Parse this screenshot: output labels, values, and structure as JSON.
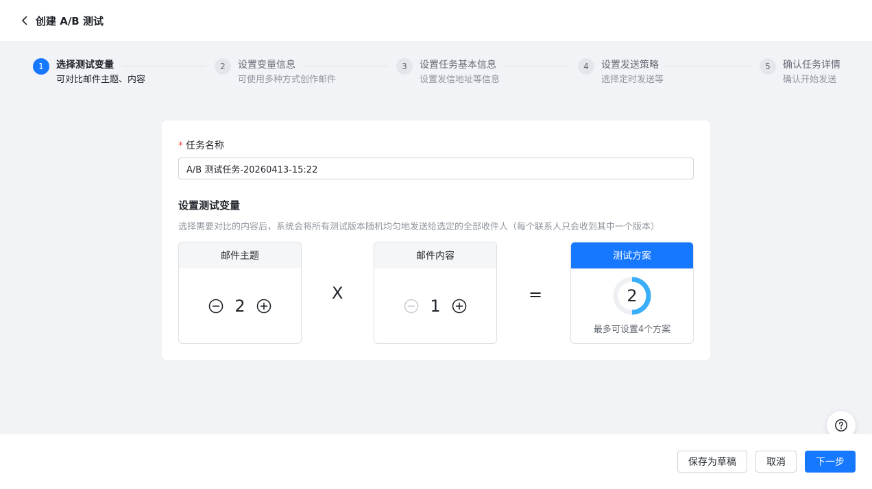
{
  "header": {
    "title": "创建 A/B 测试"
  },
  "steps": [
    {
      "num": "1",
      "title": "选择测试变量",
      "desc": "可对比邮件主题、内容",
      "active": true
    },
    {
      "num": "2",
      "title": "设置变量信息",
      "desc": "可使用多种方式创作邮件"
    },
    {
      "num": "3",
      "title": "设置任务基本信息",
      "desc": "设置发信地址等信息"
    },
    {
      "num": "4",
      "title": "设置发送策略",
      "desc": "选择定时发送等"
    },
    {
      "num": "5",
      "title": "确认任务详情",
      "desc": "确认开始发送"
    }
  ],
  "form": {
    "required_mark": "*",
    "name_label": "任务名称",
    "name_value": "A/B 测试任务-20260413-15:22",
    "section_title": "设置测试变量",
    "section_desc": "选择需要对比的内容后，系统会将所有测试版本随机均匀地发送给选定的全部收件人（每个联系人只会收到其中一个版本）"
  },
  "variables": {
    "subject": {
      "label": "邮件主题",
      "count": "2",
      "minus_enabled": true
    },
    "content": {
      "label": "邮件内容",
      "count": "1",
      "minus_enabled": false
    },
    "multiply_symbol": "X",
    "equals_symbol": "="
  },
  "plan": {
    "label": "测试方案",
    "count": "2",
    "max": 4,
    "note": "最多可设置4个方案"
  },
  "footer": {
    "save_draft": "保存为草稿",
    "cancel": "取消",
    "next": "下一步"
  },
  "colors": {
    "primary": "#1677ff",
    "ring": "#3aaef8",
    "ring_track": "#eef0f3",
    "required": "#f54a45"
  },
  "icons": {
    "back": "chevron-left-icon",
    "minus": "minus-circle-icon",
    "plus": "plus-circle-icon",
    "help": "help-circle-icon"
  }
}
